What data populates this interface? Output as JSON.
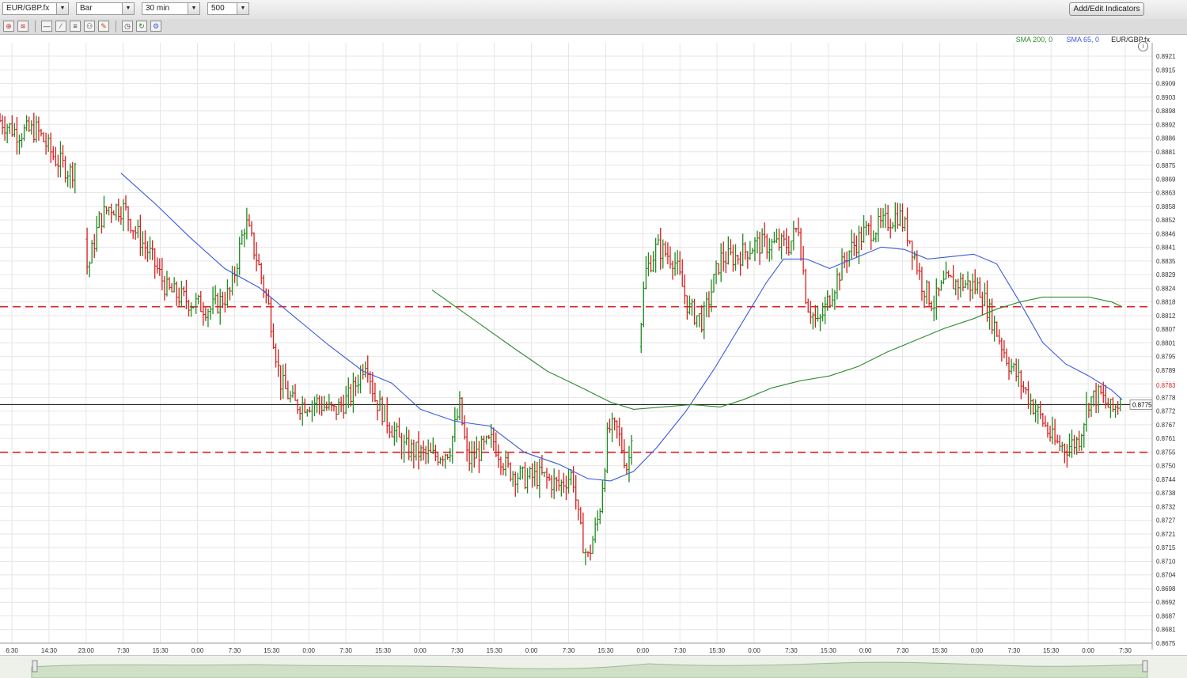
{
  "toolbar": {
    "symbol": "EUR/GBP.fx",
    "chart_type": "Bar",
    "interval": "30 min",
    "bars": "500",
    "add_indicators": "Add/Edit Indicators"
  },
  "chart_data": {
    "type": "bar",
    "symbol": "EUR/GBP.fx",
    "legend": [
      {
        "name": "SMA 200, 0",
        "color": "#2e8b2e"
      },
      {
        "name": "SMA 65, 0",
        "color": "#3b5bdb"
      },
      {
        "name": "EUR/GBP.fx",
        "color": "#222222"
      }
    ],
    "y_range": [
      0.8675,
      0.8921
    ],
    "y_ticks": [
      "0.8921",
      "0.8915",
      "0.8909",
      "0.8903",
      "0.8898",
      "0.8892",
      "0.8886",
      "0.8881",
      "0.8875",
      "0.8869",
      "0.8863",
      "0.8858",
      "0.8852",
      "0.8846",
      "0.8841",
      "0.8835",
      "0.8829",
      "0.8824",
      "0.8818",
      "0.8812",
      "0.8807",
      "0.8801",
      "0.8795",
      "0.8789",
      "0.8783",
      "0.8778",
      "0.8772",
      "0.8767",
      "0.8761",
      "0.8755",
      "0.8750",
      "0.8744",
      "0.8738",
      "0.8732",
      "0.8727",
      "0.8721",
      "0.8715",
      "0.8710",
      "0.8704",
      "0.8698",
      "0.8692",
      "0.8687",
      "0.8681",
      "0.8675"
    ],
    "x_ticks": [
      "6:30",
      "14:30",
      "23:00",
      "7:30",
      "15:30",
      "0:00",
      "7:30",
      "15:30",
      "0:00",
      "7:30",
      "15:30",
      "0:00",
      "7:30",
      "15:30",
      "0:00",
      "7:30",
      "15:30",
      "0:00",
      "7:30",
      "15:30",
      "0:00",
      "7:30",
      "15:30",
      "0:00",
      "7:30",
      "15:30",
      "0:00",
      "7:30",
      "15:30",
      "0:00",
      "7:30"
    ],
    "x_range": [
      0,
      100
    ],
    "last_price": "0.8775",
    "highlight_price": "0.8783",
    "horizontal_lines": [
      {
        "y": 0.8816,
        "style": "dashed",
        "color": "#e02020"
      },
      {
        "y": 0.8755,
        "style": "dashed",
        "color": "#e02020"
      },
      {
        "y": 0.8775,
        "style": "solid",
        "color": "#000000"
      }
    ],
    "price_path": [
      [
        0.0,
        0.8894
      ],
      [
        1.5,
        0.8889
      ],
      [
        3.2,
        0.889
      ],
      [
        4.8,
        0.8878
      ],
      [
        6.2,
        0.8872
      ],
      [
        6.7,
        0.8879
      ],
      [
        7.6,
        0.8831
      ],
      [
        8.6,
        0.8852
      ],
      [
        9.5,
        0.8858
      ],
      [
        10.8,
        0.8857
      ],
      [
        11.7,
        0.8848
      ],
      [
        13.0,
        0.8838
      ],
      [
        14.5,
        0.8823
      ],
      [
        16.5,
        0.8818
      ],
      [
        18.3,
        0.8815
      ],
      [
        20.0,
        0.8822
      ],
      [
        21.3,
        0.8852
      ],
      [
        22.3,
        0.8836
      ],
      [
        23.4,
        0.8814
      ],
      [
        24.3,
        0.8785
      ],
      [
        25.5,
        0.8775
      ],
      [
        27.5,
        0.8776
      ],
      [
        29.0,
        0.8772
      ],
      [
        30.5,
        0.8779
      ],
      [
        31.8,
        0.8795
      ],
      [
        32.5,
        0.8778
      ],
      [
        33.8,
        0.8767
      ],
      [
        35.0,
        0.8757
      ],
      [
        37.5,
        0.8753
      ],
      [
        39.0,
        0.8756
      ],
      [
        39.9,
        0.8774
      ],
      [
        40.6,
        0.8751
      ],
      [
        41.5,
        0.8755
      ],
      [
        42.8,
        0.876
      ],
      [
        44.0,
        0.8748
      ],
      [
        45.5,
        0.8744
      ],
      [
        47.0,
        0.8745
      ],
      [
        48.5,
        0.8741
      ],
      [
        49.7,
        0.8746
      ],
      [
        50.3,
        0.8723
      ],
      [
        51.0,
        0.871
      ],
      [
        52.0,
        0.8729
      ],
      [
        52.8,
        0.8765
      ],
      [
        53.6,
        0.8764
      ],
      [
        54.5,
        0.8747
      ],
      [
        55.0,
        0.8775
      ],
      [
        56.0,
        0.883
      ],
      [
        57.0,
        0.8841
      ],
      [
        58.5,
        0.8836
      ],
      [
        59.8,
        0.8815
      ],
      [
        61.0,
        0.881
      ],
      [
        62.5,
        0.8836
      ],
      [
        64.0,
        0.8837
      ],
      [
        65.5,
        0.8842
      ],
      [
        67.0,
        0.8842
      ],
      [
        68.5,
        0.8842
      ],
      [
        69.3,
        0.885
      ],
      [
        70.0,
        0.8818
      ],
      [
        71.0,
        0.8808
      ],
      [
        72.0,
        0.882
      ],
      [
        73.5,
        0.8838
      ],
      [
        75.0,
        0.8847
      ],
      [
        76.5,
        0.885
      ],
      [
        78.0,
        0.8855
      ],
      [
        79.0,
        0.8844
      ],
      [
        80.0,
        0.8826
      ],
      [
        81.0,
        0.8817
      ],
      [
        82.0,
        0.8826
      ],
      [
        83.5,
        0.8826
      ],
      [
        85.0,
        0.8824
      ],
      [
        86.0,
        0.8812
      ],
      [
        87.5,
        0.8793
      ],
      [
        88.5,
        0.8785
      ],
      [
        89.5,
        0.8776
      ],
      [
        90.5,
        0.8768
      ],
      [
        91.5,
        0.8759
      ],
      [
        92.5,
        0.8757
      ],
      [
        93.6,
        0.876
      ],
      [
        94.5,
        0.8777
      ],
      [
        95.5,
        0.8779
      ],
      [
        96.5,
        0.8772
      ],
      [
        97.4,
        0.8778
      ]
    ],
    "gaps_after": [
      6.7,
      55.0
    ],
    "sma65": [
      [
        10.5,
        0.8872
      ],
      [
        13.5,
        0.8859
      ],
      [
        16.5,
        0.8845
      ],
      [
        19.5,
        0.8832
      ],
      [
        22.5,
        0.8824
      ],
      [
        25.5,
        0.8812
      ],
      [
        28.5,
        0.88
      ],
      [
        31.5,
        0.8789
      ],
      [
        34.0,
        0.8784
      ],
      [
        36.5,
        0.8773
      ],
      [
        39.5,
        0.8768
      ],
      [
        42.5,
        0.8766
      ],
      [
        45.5,
        0.8755
      ],
      [
        48.5,
        0.875
      ],
      [
        51.0,
        0.8744
      ],
      [
        53.0,
        0.8743
      ],
      [
        55.0,
        0.8747
      ],
      [
        57.0,
        0.8757
      ],
      [
        59.5,
        0.8772
      ],
      [
        62.0,
        0.879
      ],
      [
        64.5,
        0.881
      ],
      [
        66.5,
        0.8826
      ],
      [
        68.0,
        0.8836
      ],
      [
        70.0,
        0.8836
      ],
      [
        72.0,
        0.8832
      ],
      [
        74.5,
        0.8837
      ],
      [
        76.5,
        0.8841
      ],
      [
        78.5,
        0.884
      ],
      [
        80.5,
        0.8836
      ],
      [
        82.5,
        0.8837
      ],
      [
        84.5,
        0.8838
      ],
      [
        86.5,
        0.8834
      ],
      [
        88.5,
        0.8818
      ],
      [
        90.5,
        0.8801
      ],
      [
        92.5,
        0.8792
      ],
      [
        94.5,
        0.8787
      ],
      [
        96.5,
        0.8781
      ],
      [
        97.4,
        0.8777
      ]
    ],
    "sma200": [
      [
        37.5,
        0.8823
      ],
      [
        41.0,
        0.8811
      ],
      [
        44.5,
        0.8799
      ],
      [
        47.5,
        0.8789
      ],
      [
        50.5,
        0.8782
      ],
      [
        53.0,
        0.8776
      ],
      [
        55.0,
        0.8773
      ],
      [
        57.5,
        0.8774
      ],
      [
        60.0,
        0.8775
      ],
      [
        62.5,
        0.8774
      ],
      [
        64.5,
        0.8777
      ],
      [
        67.0,
        0.8782
      ],
      [
        69.5,
        0.8785
      ],
      [
        72.0,
        0.8787
      ],
      [
        74.5,
        0.8791
      ],
      [
        77.0,
        0.8797
      ],
      [
        79.5,
        0.8802
      ],
      [
        82.0,
        0.8807
      ],
      [
        84.5,
        0.8811
      ],
      [
        86.5,
        0.8815
      ],
      [
        88.5,
        0.8818
      ],
      [
        90.5,
        0.882
      ],
      [
        92.5,
        0.882
      ],
      [
        94.5,
        0.882
      ],
      [
        96.5,
        0.8818
      ],
      [
        97.4,
        0.8816
      ]
    ]
  }
}
